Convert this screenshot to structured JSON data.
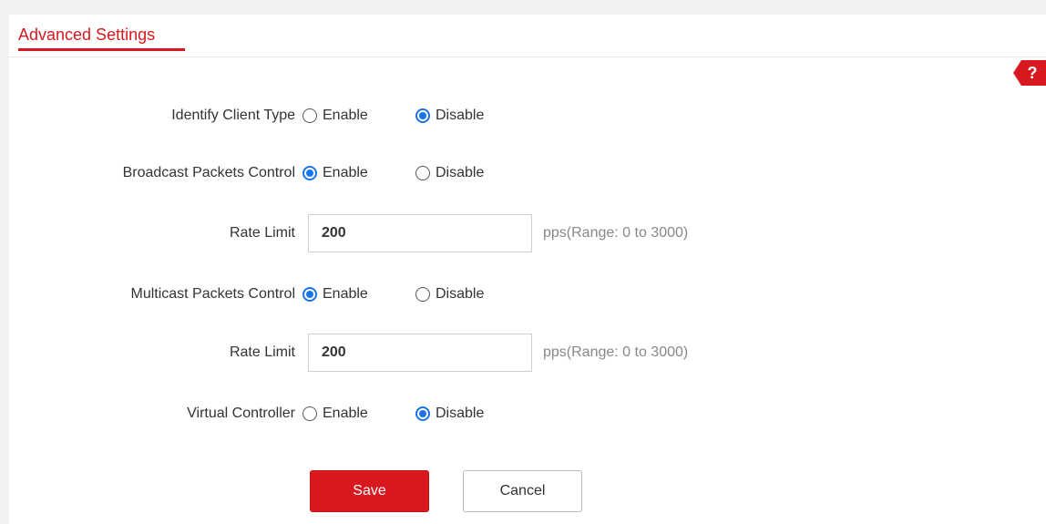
{
  "header": {
    "title": "Advanced Settings",
    "help_label": "?"
  },
  "settings": {
    "identify_client_type": {
      "label": "Identify Client Type",
      "enable_label": "Enable",
      "disable_label": "Disable",
      "selected": "Disable"
    },
    "broadcast_packets_control": {
      "label": "Broadcast Packets Control",
      "enable_label": "Enable",
      "disable_label": "Disable",
      "selected": "Enable"
    },
    "broadcast_rate_limit": {
      "label": "Rate Limit",
      "value": "200",
      "hint": "pps(Range: 0 to 3000)"
    },
    "multicast_packets_control": {
      "label": "Multicast Packets Control",
      "enable_label": "Enable",
      "disable_label": "Disable",
      "selected": "Enable"
    },
    "multicast_rate_limit": {
      "label": "Rate Limit",
      "value": "200",
      "hint": "pps(Range: 0 to 3000)"
    },
    "virtual_controller": {
      "label": "Virtual Controller",
      "enable_label": "Enable",
      "disable_label": "Disable",
      "selected": "Disable"
    }
  },
  "actions": {
    "save_label": "Save",
    "cancel_label": "Cancel"
  },
  "colors": {
    "accent": "#d7191f",
    "radio_selected": "#1a73e8",
    "hint_text": "#888888"
  }
}
